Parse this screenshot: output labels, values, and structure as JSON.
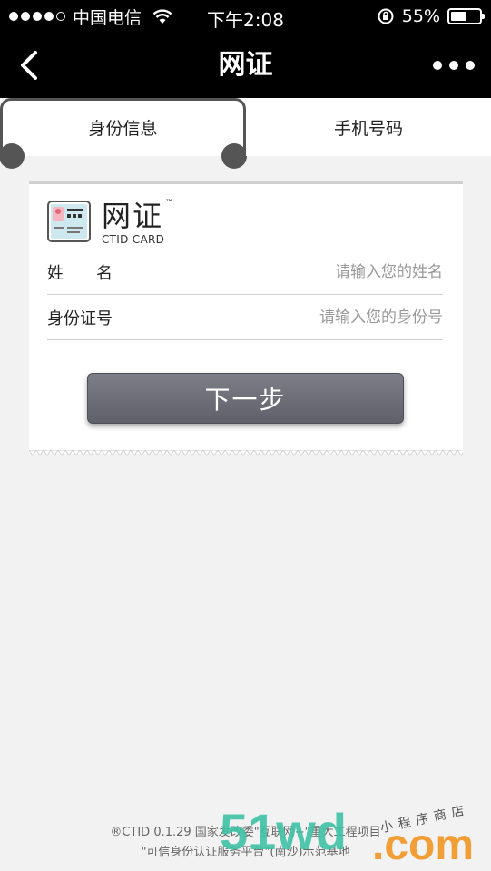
{
  "status_bar": {
    "carrier": "中国电信",
    "time": "下午2:08",
    "battery": "55%",
    "battery_level": 0.55
  },
  "nav": {
    "title": "网证",
    "back_icon": "chevron-left-icon",
    "more_icon": "more-dots-icon"
  },
  "tabs": [
    {
      "label": "身份信息",
      "active": true
    },
    {
      "label": "手机号码",
      "active": false
    }
  ],
  "card": {
    "brand_title": "网证",
    "brand_tm": "™",
    "brand_subtitle": "CTID CARD"
  },
  "form": {
    "name_label": "姓　　名",
    "name_placeholder": "请输入您的姓名",
    "id_label": "身份证号",
    "id_placeholder": "请输入您的身份号",
    "next_label": "下一步"
  },
  "footer": {
    "line1": "®CTID 0.1.29 国家发改委\"互联网+\"重大工程项目",
    "line2": "\"可信身份认证服务平台\"(南沙)示范基地"
  },
  "watermark": {
    "main": "51wd",
    "tld": ".com",
    "hand": "小程序商店"
  },
  "colors": {
    "bar": "#000000",
    "page_bg": "#f2f2f2",
    "button": "#6b6c74"
  }
}
